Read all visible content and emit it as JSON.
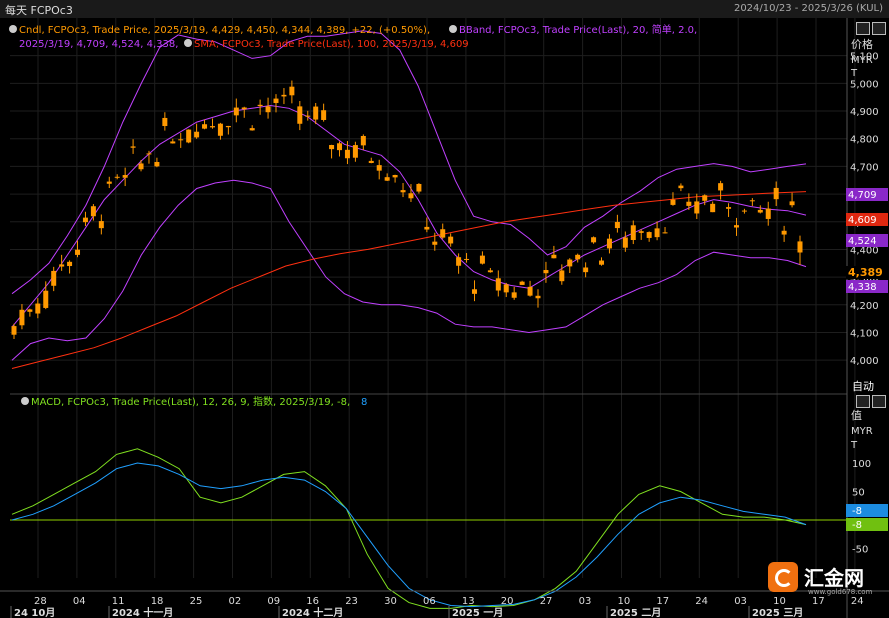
{
  "window": {
    "title": "每天 FCPOc3",
    "date_range": "2024/10/23 - 2025/3/26 (KUL)"
  },
  "legend": {
    "cndl": "Cndl, FCPOc3, Trade Price, 2025/3/19, 4,429, 4,450, 4,344, 4,389, +22, (+0.50%),",
    "bband_line1": "BBand, FCPOc3, Trade Price(Last), 20, 简单, 2.0,",
    "bband_line2": "2025/3/19, 4,709, 4,524, 4,338,",
    "sma": "SMA, FCPOc3, Trade Price(Last), 100, 2025/3/19, 4,609",
    "macd": "MACD, FCPOc3, Trade Price(Last), 12, 26, 9, 指数, 2025/3/19, -8,",
    "macd_last": "8"
  },
  "price_axis": {
    "unit_line1": "价格",
    "unit_line2": "MYR",
    "unit_line3": "T",
    "auto_label": "自动",
    "ticks": [
      "5,100",
      "5,000",
      "4,900",
      "4,800",
      "4,700",
      "4,600",
      "4,500",
      "4,400",
      "4,300",
      "4,200",
      "4,100",
      "4,000"
    ]
  },
  "macd_axis": {
    "unit_line1": "值",
    "unit_line2": "MYR",
    "unit_line3": "T",
    "ticks": [
      "100",
      "50",
      "-50"
    ]
  },
  "badges": {
    "bb_upper": "4,709",
    "sma": "4,609",
    "bb_mid": "4,524",
    "last": "4,389",
    "bb_lower": "4,338",
    "macd_signal": "-8",
    "macd_line": "-8"
  },
  "x_axis": {
    "days": [
      "28",
      "04",
      "11",
      "18",
      "25",
      "02",
      "09",
      "16",
      "23",
      "30",
      "06",
      "13",
      "20",
      "27",
      "03",
      "10",
      "17",
      "24",
      "03",
      "10",
      "17",
      "24"
    ],
    "months": [
      "24 10月",
      "2024 十一月",
      "2024 十二月",
      "2025 一月",
      "2025 二月",
      "2025 三月"
    ]
  },
  "watermark": {
    "brand": "汇金网",
    "url": "www.gold678.com"
  },
  "colors": {
    "candle": "#ff9900",
    "bband": "#c040ff",
    "sma": "#ff3010",
    "macd": "#80e020",
    "signal": "#20a0ff",
    "zero": "#90d000"
  },
  "chart_data": {
    "type": "candlestick",
    "symbol": "FCPOc3",
    "last_ohlc": {
      "date": "2025/3/19",
      "open": 4429,
      "high": 4450,
      "low": 4344,
      "close": 4389
    },
    "ylim": [
      3950,
      5200
    ],
    "series": [
      {
        "name": "BBand upper",
        "values": [
          4240,
          4290,
          4350,
          4450,
          4560,
          4700,
          4860,
          5000,
          5130,
          5175,
          5160,
          5150,
          5120,
          5090,
          5100,
          5150,
          5170,
          5170,
          5180,
          5190,
          5180,
          5120,
          4990,
          4820,
          4650,
          4520,
          4500,
          4490,
          4440,
          4380,
          4410,
          4480,
          4520,
          4570,
          4610,
          4660,
          4690,
          4700,
          4710,
          4700,
          4680,
          4690,
          4700,
          4709
        ]
      },
      {
        "name": "BBand middle",
        "values": [
          4120,
          4200,
          4280,
          4380,
          4480,
          4580,
          4650,
          4720,
          4780,
          4820,
          4860,
          4880,
          4900,
          4910,
          4920,
          4910,
          4880,
          4830,
          4780,
          4760,
          4740,
          4680,
          4580,
          4460,
          4380,
          4320,
          4290,
          4270,
          4260,
          4300,
          4340,
          4380,
          4410,
          4440,
          4470,
          4500,
          4530,
          4560,
          4580,
          4570,
          4555,
          4545,
          4540,
          4524
        ]
      },
      {
        "name": "BBand lower",
        "values": [
          4000,
          4060,
          4080,
          4070,
          4080,
          4150,
          4250,
          4380,
          4480,
          4560,
          4620,
          4640,
          4650,
          4640,
          4620,
          4500,
          4400,
          4300,
          4240,
          4210,
          4200,
          4200,
          4190,
          4170,
          4130,
          4120,
          4120,
          4110,
          4100,
          4110,
          4120,
          4160,
          4200,
          4230,
          4260,
          4280,
          4310,
          4360,
          4390,
          4380,
          4370,
          4370,
          4360,
          4338
        ]
      },
      {
        "name": "SMA",
        "values": [
          3970,
          3995,
          4020,
          4045,
          4080,
          4120,
          4160,
          4210,
          4260,
          4300,
          4340,
          4365,
          4385,
          4400,
          4420,
          4440,
          4460,
          4480,
          4500,
          4515,
          4530,
          4545,
          4560,
          4570,
          4580,
          4590,
          4595,
          4600,
          4605,
          4609
        ]
      },
      {
        "name": "MACD",
        "values": [
          10,
          25,
          45,
          65,
          85,
          115,
          125,
          110,
          90,
          40,
          30,
          40,
          60,
          80,
          85,
          60,
          20,
          -60,
          -120,
          -145,
          -155,
          -155,
          -150,
          -152,
          -150,
          -140,
          -120,
          -90,
          -40,
          10,
          45,
          60,
          50,
          30,
          10,
          5,
          5,
          0,
          -8
        ]
      },
      {
        "name": "Signal",
        "values": [
          0,
          10,
          25,
          45,
          65,
          90,
          100,
          95,
          80,
          60,
          55,
          60,
          70,
          75,
          70,
          50,
          20,
          -30,
          -80,
          -120,
          -140,
          -150,
          -152,
          -150,
          -148,
          -140,
          -125,
          -100,
          -65,
          -25,
          10,
          30,
          40,
          35,
          25,
          15,
          10,
          5,
          -8
        ]
      }
    ],
    "xlabel": "",
    "ylabel": "价格 MYR T"
  }
}
